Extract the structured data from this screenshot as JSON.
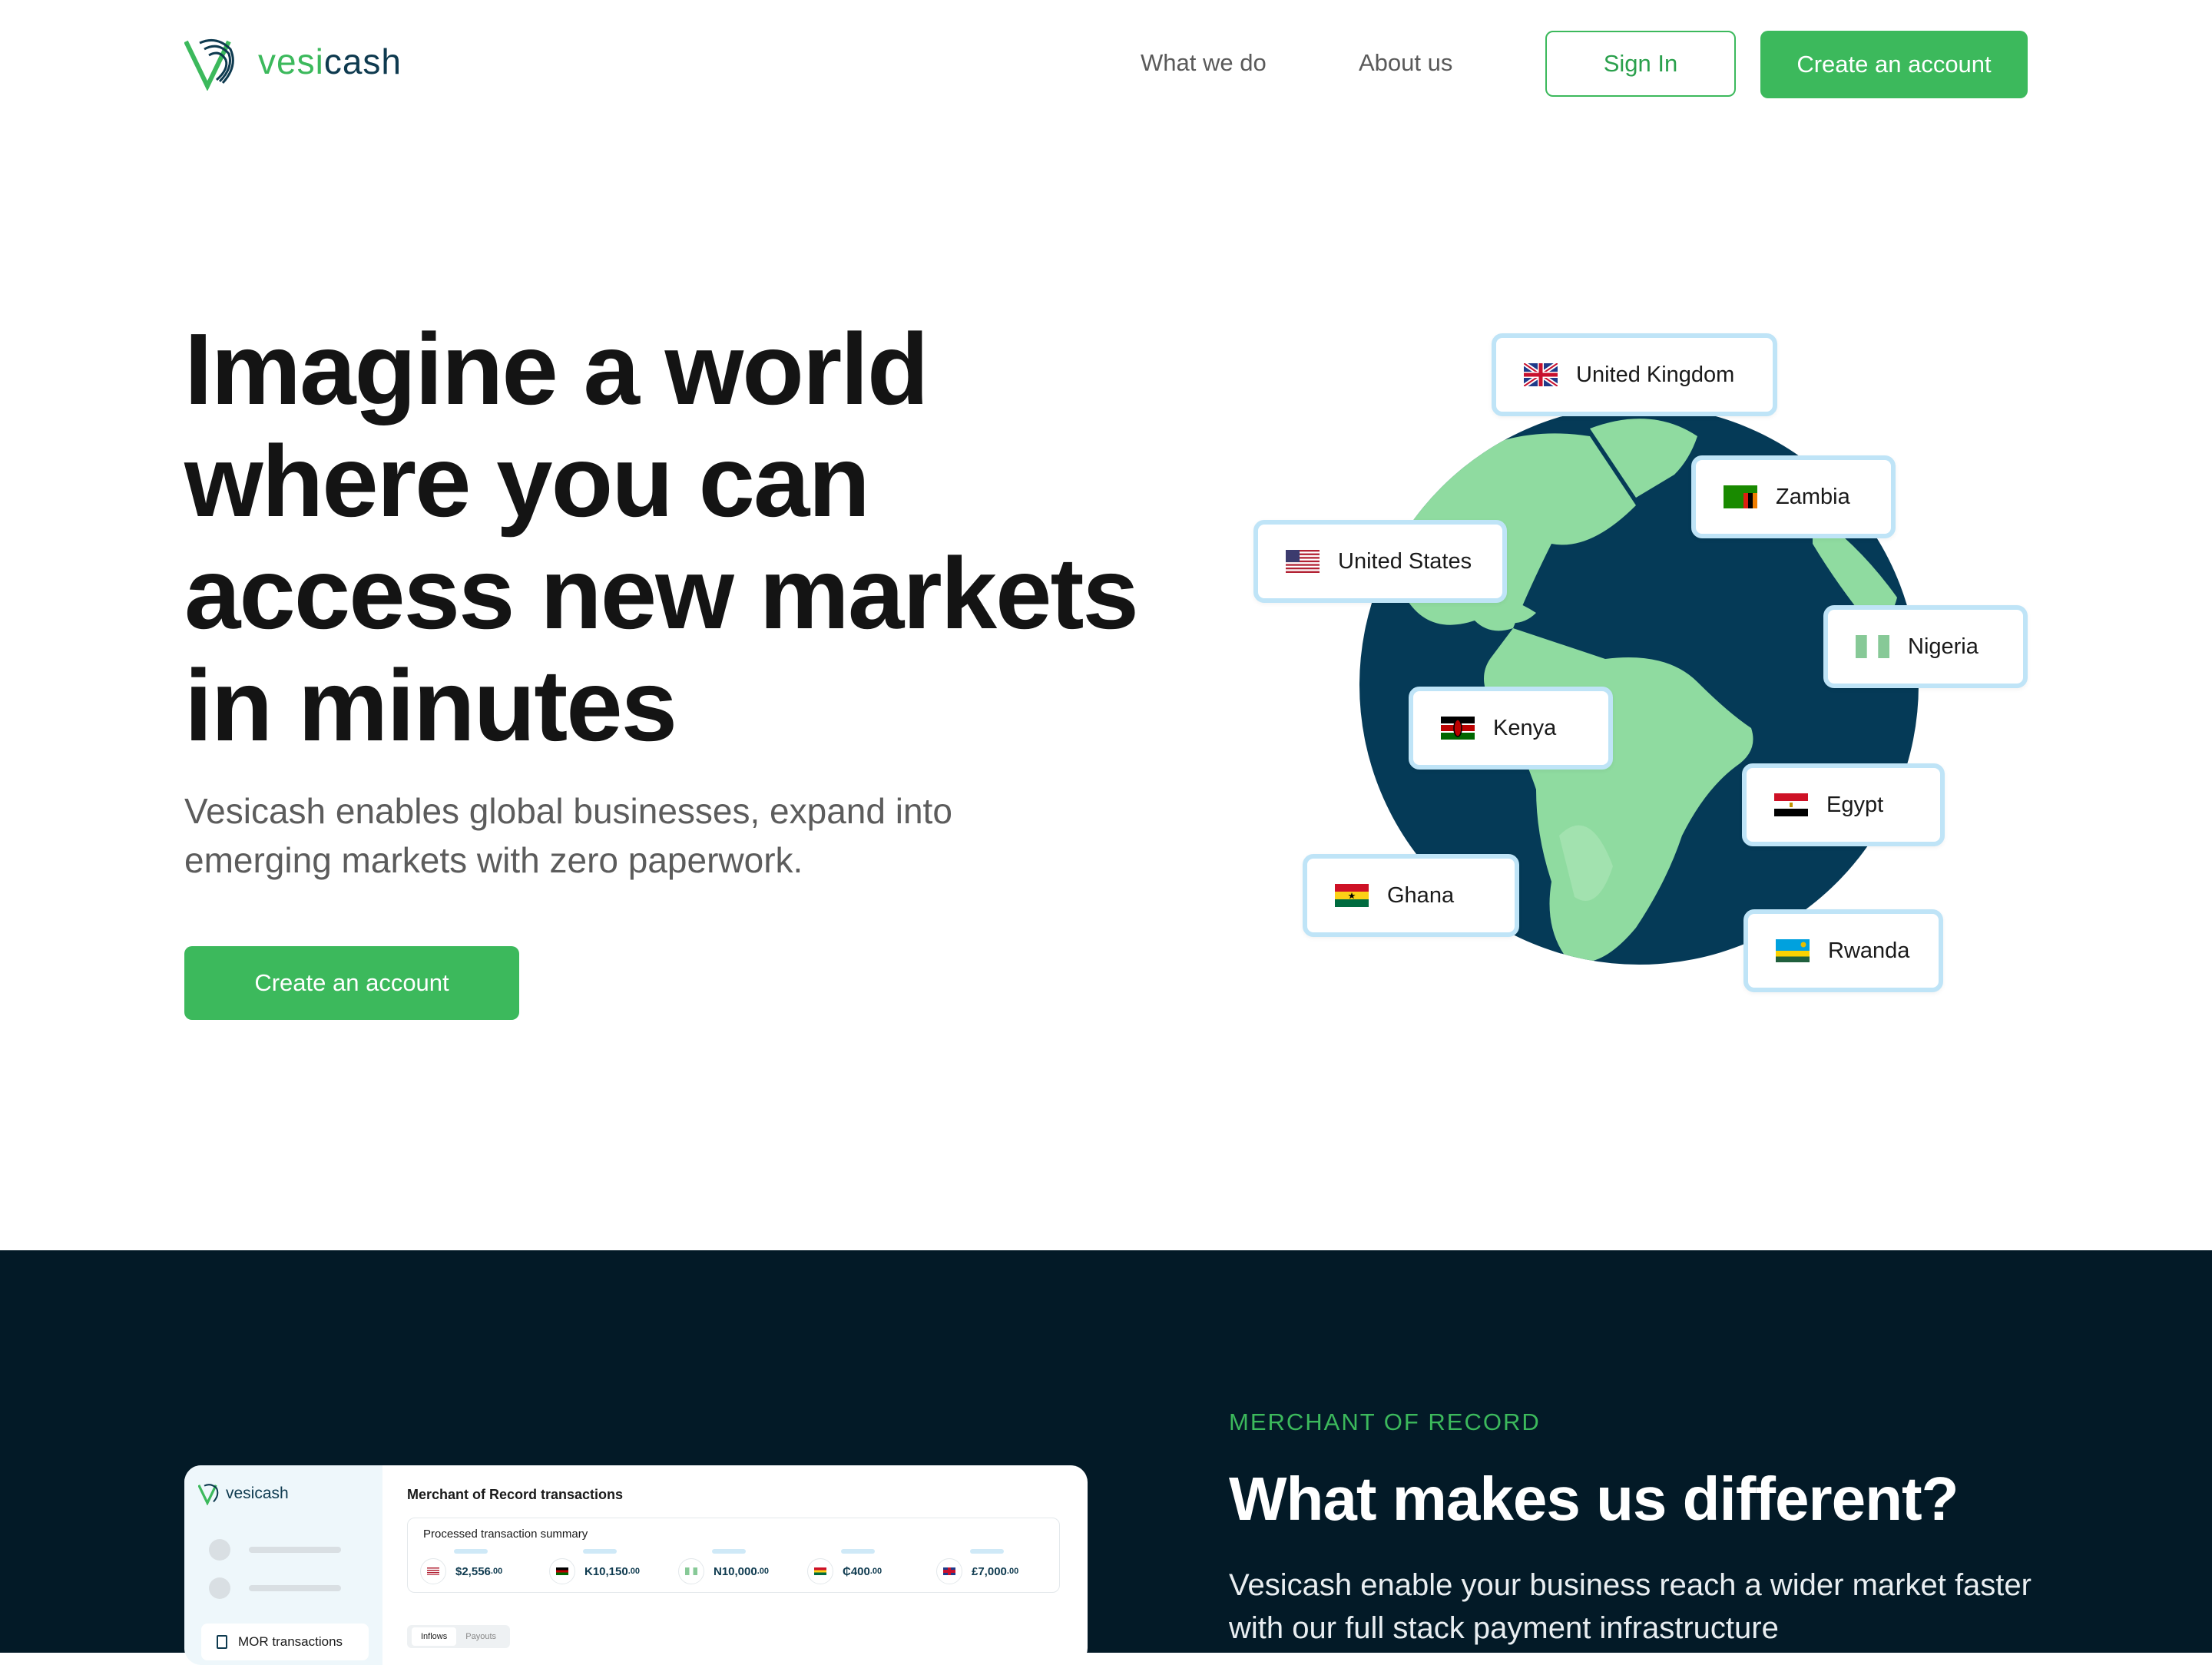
{
  "header": {
    "logo_text_a": "vesi",
    "logo_text_b": "cash",
    "nav": [
      {
        "label": "What we do"
      },
      {
        "label": "About us"
      }
    ],
    "sign_in": "Sign In",
    "create_account": "Create an account"
  },
  "hero": {
    "title": "Imagine a world where you can access new markets in minutes",
    "subtitle": "Vesicash enables global businesses, expand into emerging markets with zero paperwork.",
    "cta": "Create an account"
  },
  "countries": [
    {
      "name": "United Kingdom",
      "flag": "uk-flag-icon"
    },
    {
      "name": "Zambia",
      "flag": "zambia-flag-icon"
    },
    {
      "name": "United States",
      "flag": "us-flag-icon"
    },
    {
      "name": "Nigeria",
      "flag": "nigeria-flag-icon"
    },
    {
      "name": "Kenya",
      "flag": "kenya-flag-icon"
    },
    {
      "name": "Egypt",
      "flag": "egypt-flag-icon"
    },
    {
      "name": "Ghana",
      "flag": "ghana-flag-icon"
    },
    {
      "name": "Rwanda",
      "flag": "rwanda-flag-icon"
    }
  ],
  "merchant": {
    "eyebrow": "MERCHANT OF RECORD",
    "title": "What makes us different?",
    "subtitle": "Vesicash enable your business reach a wider market faster with our full stack payment infrastructure"
  },
  "dashboard": {
    "logo": "vesicash",
    "nav_item": "MOR transactions",
    "title": "Merchant of Record transactions",
    "card_title": "Processed transaction summary",
    "amounts": [
      {
        "value": "$2,556",
        "decimals": ".00"
      },
      {
        "value": "K10,150",
        "decimals": ".00"
      },
      {
        "value": "N10,000",
        "decimals": ".00"
      },
      {
        "value": "₵400",
        "decimals": ".00"
      },
      {
        "value": "£7,000",
        "decimals": ".00"
      }
    ],
    "tabs": [
      "Inflows",
      "Payouts"
    ]
  },
  "colors": {
    "brand_green": "#3cb95c",
    "navy": "#0e3a4f",
    "dark_bg": "#031a27",
    "country_border": "#bfe4f7"
  }
}
